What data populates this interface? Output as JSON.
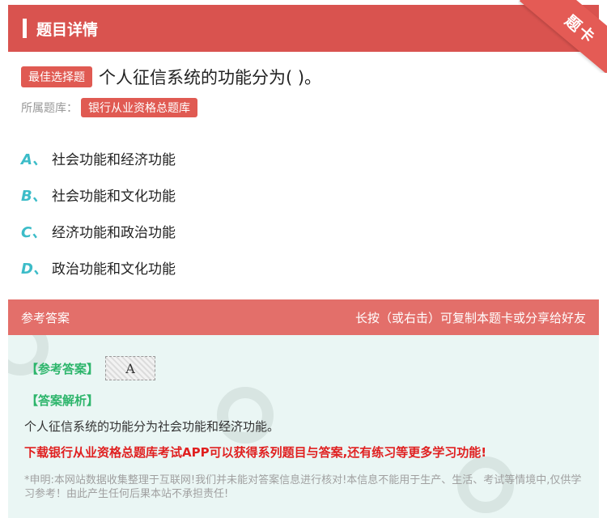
{
  "header": {
    "title": "题目详情"
  },
  "corner": {
    "label": "题卡"
  },
  "question": {
    "type_tag": "最佳选择题",
    "text": "个人征信系统的功能分为( )。"
  },
  "bank": {
    "label": "所属题库：",
    "name": "银行从业资格总题库"
  },
  "options": [
    {
      "letter": "A、",
      "text": "社会功能和经济功能"
    },
    {
      "letter": "B、",
      "text": "社会功能和文化功能"
    },
    {
      "letter": "C、",
      "text": "经济功能和政治功能"
    },
    {
      "letter": "D、",
      "text": "政治功能和文化功能"
    }
  ],
  "answer": {
    "header_label": "参考答案",
    "header_hint": "长按（或右击）可复制本题卡或分享给好友",
    "ref_label": "【参考答案】",
    "ref_value": "A",
    "analysis_label": "【答案解析】",
    "analysis_text": "个人征信系统的功能分为社会功能和经济功能。",
    "promo": "下载银行从业资格总题库考试APP可以获得系列题目与答案,还有练习等更多学习功能!",
    "disclaimer": "*申明:本网站数据收集整理于互联网!我们并未能对答案信息进行核对!本信息不能用于生产、生活、考试等情境中,仅供学习参考！由此产生任何后果本站不承担责任!"
  },
  "colors": {
    "accent": "#d9534f",
    "answer_header": "#e36f6a",
    "option_letter": "#3cbcc8",
    "answer_label": "#2db56b",
    "promo": "#e02020",
    "answer_bg": "#eaf6f4"
  }
}
